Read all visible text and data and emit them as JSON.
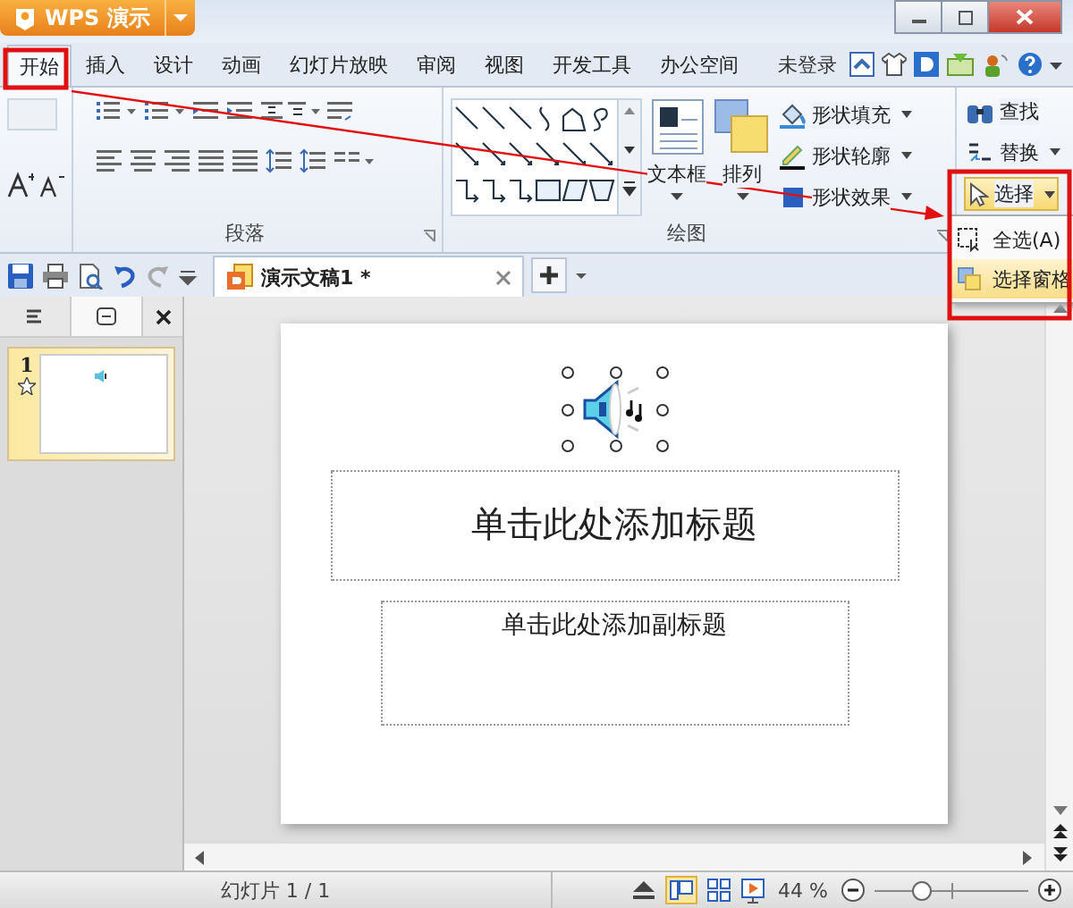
{
  "app_button": {
    "label": "WPS 演示"
  },
  "ribbon_tabs": [
    {
      "label": "开始",
      "selected": true
    },
    {
      "label": "插入",
      "selected": false
    },
    {
      "label": "设计",
      "selected": false
    },
    {
      "label": "动画",
      "selected": false
    },
    {
      "label": "幻灯片放映",
      "selected": false
    },
    {
      "label": "审阅",
      "selected": false
    },
    {
      "label": "视图",
      "selected": false
    },
    {
      "label": "开发工具",
      "selected": false
    },
    {
      "label": "办公空间",
      "selected": false
    }
  ],
  "account": {
    "label": "未登录"
  },
  "ribbon": {
    "paragraph_group": {
      "title": "段落"
    },
    "drawing_group": {
      "title": "绘图",
      "text_box": "文本框",
      "arrange": "排列",
      "shape_fill": "形状填充",
      "shape_outline": "形状轮廓",
      "shape_effect": "形状效果"
    },
    "editing_group": {
      "find": "查找",
      "replace": "替换",
      "select": {
        "label": "选择",
        "expanded": true
      }
    }
  },
  "select_menu": [
    {
      "label": "全选(A)",
      "selected": false
    },
    {
      "label": "选择窗格",
      "selected": true
    }
  ],
  "document_tab": {
    "title": "演示文稿1 *"
  },
  "slide_panel": {
    "thumbnails": [
      {
        "number": "1",
        "selected": true
      }
    ]
  },
  "slide": {
    "title_placeholder": "单击此处添加标题",
    "subtitle_placeholder": "单击此处添加副标题"
  },
  "status_bar": {
    "slide_info": "幻灯片 1 / 1",
    "zoom": "44 %",
    "zoom_slider": {
      "level": 0.3
    }
  }
}
